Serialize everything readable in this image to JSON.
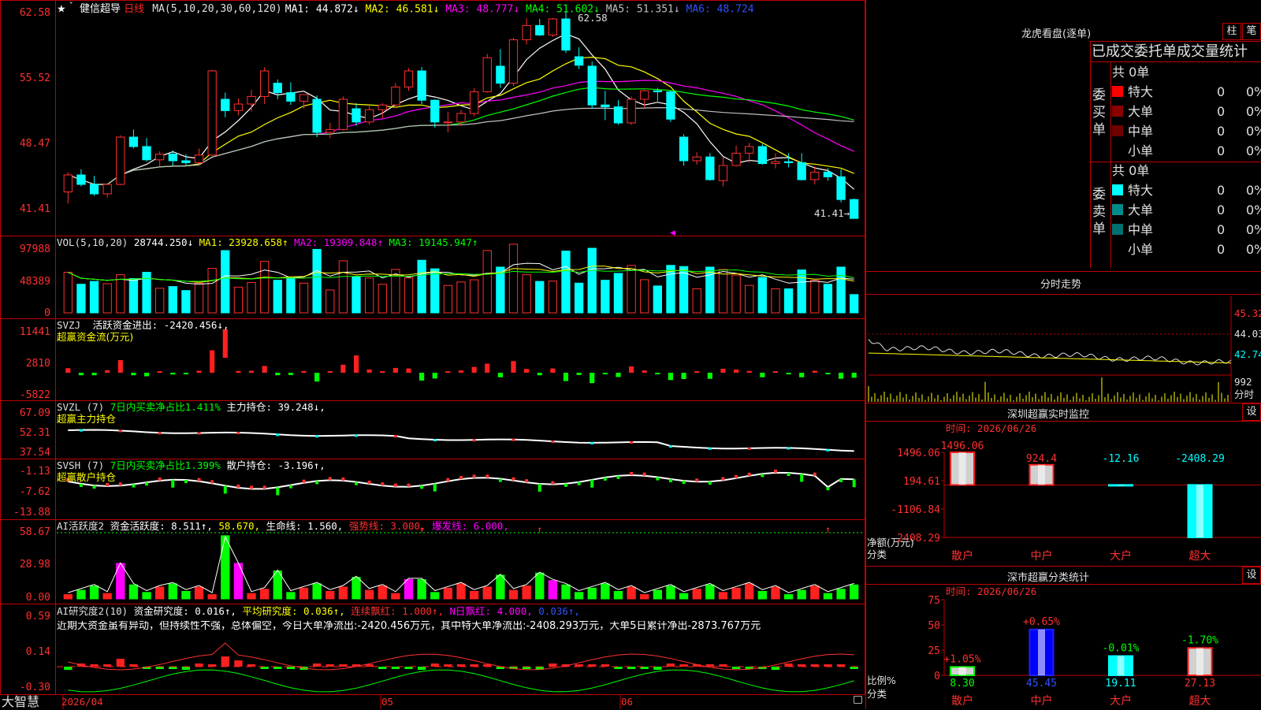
{
  "app": {
    "brand": "大智慧"
  },
  "kline": {
    "star": "★",
    "fav_mark": "˅",
    "name": "健信超导",
    "period": "日线",
    "ma_spec": "MA(5,10,20,30,60,120)",
    "ma": [
      {
        "label": "MA1: 44.872↓",
        "color": "#ffffff"
      },
      {
        "label": "MA2: 46.581↓",
        "color": "#ffff00"
      },
      {
        "label": "MA3: 48.777↓",
        "color": "#ff00ff"
      },
      {
        "label": "MA4: 51.602↓",
        "color": "#00ff00"
      },
      {
        "label": "MA5: 51.351↓",
        "color": "#c0c0c0"
      },
      {
        "label": "MA6: 48.724",
        "color": "#3050ff"
      }
    ],
    "y_ticks": [
      "62.58",
      "55.52",
      "48.47",
      "41.41"
    ],
    "high_label": "62.58",
    "low_label": "41.41→",
    "candles": [
      [
        44.2,
        46.3,
        43.0,
        46.0
      ],
      [
        46.0,
        46.6,
        44.8,
        45.0
      ],
      [
        45.0,
        45.9,
        43.8,
        44.0
      ],
      [
        44.0,
        45.1,
        43.6,
        45.0
      ],
      [
        45.0,
        50.2,
        44.9,
        50.0
      ],
      [
        50.0,
        50.8,
        48.8,
        49.0
      ],
      [
        49.0,
        49.9,
        47.4,
        47.6
      ],
      [
        47.6,
        48.5,
        46.9,
        48.2
      ],
      [
        48.2,
        48.6,
        47.0,
        47.5
      ],
      [
        47.5,
        48.2,
        47.0,
        47.3
      ],
      [
        47.3,
        48.8,
        47.1,
        48.1
      ],
      [
        48.1,
        57.1,
        48.0,
        57.0
      ],
      [
        54.0,
        54.7,
        52.1,
        52.8
      ],
      [
        52.8,
        54.1,
        52.3,
        53.5
      ],
      [
        53.5,
        55.0,
        52.7,
        54.3
      ],
      [
        54.3,
        57.4,
        53.5,
        57.0
      ],
      [
        55.7,
        56.1,
        54.0,
        54.7
      ],
      [
        54.7,
        55.8,
        53.4,
        53.8
      ],
      [
        53.8,
        54.5,
        53.0,
        54.5
      ],
      [
        54.0,
        54.4,
        50.0,
        50.5
      ],
      [
        50.5,
        51.5,
        49.9,
        50.8
      ],
      [
        50.8,
        54.3,
        50.7,
        54.0
      ],
      [
        53.0,
        53.6,
        51.2,
        51.6
      ],
      [
        51.6,
        53.4,
        51.3,
        52.9
      ],
      [
        52.9,
        53.6,
        52.0,
        53.4
      ],
      [
        53.4,
        55.7,
        53.1,
        55.3
      ],
      [
        55.3,
        57.3,
        54.9,
        57.0
      ],
      [
        57.0,
        57.4,
        53.5,
        53.9
      ],
      [
        53.9,
        54.0,
        51.0,
        51.6
      ],
      [
        51.6,
        52.7,
        50.5,
        51.6
      ],
      [
        51.6,
        52.9,
        51.2,
        52.5
      ],
      [
        52.5,
        55.2,
        52.2,
        54.8
      ],
      [
        54.8,
        58.8,
        54.7,
        58.4
      ],
      [
        57.5,
        59.3,
        55.2,
        55.7
      ],
      [
        55.7,
        60.5,
        55.4,
        60.3
      ],
      [
        60.3,
        62.6,
        59.8,
        61.8
      ],
      [
        61.8,
        62.5,
        60.7,
        60.8
      ],
      [
        60.8,
        62.6,
        60.6,
        62.5
      ],
      [
        62.5,
        63.3,
        58.9,
        59.2
      ],
      [
        58.5,
        59.5,
        57.2,
        57.6
      ],
      [
        57.5,
        58.0,
        53.0,
        53.4
      ],
      [
        53.4,
        54.9,
        51.8,
        53.2
      ],
      [
        53.2,
        53.9,
        51.3,
        51.5
      ],
      [
        51.5,
        54.3,
        51.3,
        54.0
      ],
      [
        54.0,
        55.0,
        53.1,
        54.9
      ],
      [
        54.9,
        55.2,
        53.8,
        54.8
      ],
      [
        54.8,
        54.9,
        51.6,
        51.9
      ],
      [
        50.0,
        50.3,
        47.0,
        47.5
      ],
      [
        47.5,
        48.4,
        47.1,
        47.9
      ],
      [
        47.9,
        48.3,
        45.4,
        45.5
      ],
      [
        45.4,
        47.9,
        44.8,
        47.0
      ],
      [
        47.0,
        49.1,
        46.9,
        48.3
      ],
      [
        48.3,
        49.4,
        47.3,
        49.0
      ],
      [
        49.0,
        49.3,
        47.1,
        47.2
      ],
      [
        47.2,
        48.3,
        46.7,
        47.4
      ],
      [
        47.4,
        48.3,
        46.8,
        47.3
      ],
      [
        47.3,
        48.3,
        45.4,
        45.5
      ],
      [
        45.5,
        46.9,
        45.0,
        46.3
      ],
      [
        46.3,
        46.7,
        45.4,
        45.8
      ],
      [
        45.8,
        46.6,
        43.1,
        43.4
      ],
      [
        43.4,
        43.5,
        41.4,
        41.4
      ]
    ]
  },
  "vol": {
    "title": "VOL(5,10,20)",
    "value": "28744.250↓",
    "ma1": "MA1: 23928.658↑",
    "ma2": "MA2: 19309.848↑",
    "ma3": "MA3: 19145.947↑",
    "y_ticks": [
      "97988",
      "48389",
      "0"
    ]
  },
  "svzj": {
    "title": "SVZJ",
    "line1": "活跃资金进出: -2420.456↓,",
    "line2": "超赢资金流(万元)",
    "y_ticks": [
      "11441",
      "2810",
      "-5822"
    ]
  },
  "svzl": {
    "title": "SVZL (7)",
    "ratio": "7日内买卖净占比1.411%",
    "hold": "主力持仓: 39.248↓,",
    "line2": "超赢主力持仓",
    "y_ticks": [
      "67.09",
      "52.31",
      "37.54"
    ]
  },
  "svsh": {
    "title": "SVSH (7)",
    "ratio": "7日内买卖净占比1.399%",
    "hold": "散户持仓: -3.196↑,",
    "line2": "超赢散户持仓",
    "y_ticks": [
      "-1.13",
      "-7.62",
      "-13.88"
    ]
  },
  "ai_active": {
    "title": "AI活跃度2",
    "v1": "资金活跃度: 8.511↑,",
    "v2": "58.670,",
    "v3": "生命线: 1.560,",
    "v4": "强势线: 3.000,",
    "v5": "爆发线: 6.000,",
    "y_ticks": [
      "58.67",
      "28.98",
      "0.00"
    ]
  },
  "ai_research": {
    "title": "AI研究度2(10)",
    "v1": "资金研究度: 0.016↑,",
    "v2": "平均研究度: 0.036↑,",
    "v3": "连续飘红: 1.000↑,",
    "v4": "N日飘红: 4.000,",
    "v5": "0.036↑,",
    "commentary": "近期大资金虽有异动，但持续性不强，总体偏空，今日大单净流出:-2420.456万元，其中特大单净流出:-2408.293万元，大单5日累计净出-2873.767万元",
    "y_ticks": [
      "0.59",
      "0.14",
      "-0.30"
    ]
  },
  "time_axis": {
    "labels": [
      "2026/04",
      "05",
      "06"
    ]
  },
  "right": {
    "lhb_title": "龙虎看盘(逐单)",
    "btn_col": "柱",
    "btn_pen": "笔",
    "stat_header": "已成交委托单成交量统计",
    "buy_side": {
      "label": "委买单",
      "total": "共 0单",
      "rows": [
        {
          "name": "特大",
          "color": "#ff0000",
          "qty": "0",
          "pct": "0%"
        },
        {
          "name": "大单",
          "color": "#8b0000",
          "qty": "0",
          "pct": "0%"
        },
        {
          "name": "中单",
          "color": "#700000",
          "qty": "0",
          "pct": "0%"
        },
        {
          "name": "小单",
          "color": "#000000",
          "qty": "0",
          "pct": "0%"
        }
      ]
    },
    "sell_side": {
      "label": "委卖单",
      "total": "共 0单",
      "rows": [
        {
          "name": "特大",
          "color": "#00ffff",
          "qty": "0",
          "pct": "0%"
        },
        {
          "name": "大单",
          "color": "#008b8b",
          "qty": "0",
          "pct": "0%"
        },
        {
          "name": "中单",
          "color": "#007070",
          "qty": "0",
          "pct": "0%"
        },
        {
          "name": "小单",
          "color": "#000000",
          "qty": "0",
          "pct": "0%"
        }
      ]
    },
    "intraday": {
      "title": "分时走势",
      "y_ticks": [
        "45.32",
        "44.03",
        "42.74"
      ],
      "vol_label": "992",
      "vol_unit": "分时"
    },
    "monitor": {
      "title": "深圳超赢实时监控",
      "btn": "设",
      "time": "时间: 2026/06/26",
      "y_ticks": [
        "1496.06",
        "194.61",
        "-1106.84",
        "-2408.29"
      ],
      "y_unit": "净额(万元)",
      "x_unit": "分类",
      "chart_data": {
        "type": "bar",
        "categories": [
          "散户",
          "中户",
          "大户",
          "超大"
        ],
        "values": [
          1496.06,
          924.4,
          -12.16,
          -2408.29
        ],
        "labels": [
          "1496.06",
          "924.4",
          "-12.16",
          "-2408.29"
        ],
        "ylim": [
          -2408.29,
          1496.06
        ]
      }
    },
    "classify": {
      "title": "深市超赢分类统计",
      "btn": "设",
      "time": "时间: 2026/06/26",
      "y_ticks": [
        "75",
        "50",
        "25",
        "0"
      ],
      "y_unit": "比例%",
      "x_unit": "分类",
      "chart_data": {
        "type": "bar",
        "categories": [
          "散户",
          "中户",
          "大户",
          "超大"
        ],
        "values": [
          8.3,
          45.45,
          19.11,
          27.13
        ],
        "labels": [
          "8.30",
          "45.45",
          "19.11",
          "27.13"
        ],
        "changes": [
          "+1.05%",
          "+0.65%",
          "-0.01%",
          "-1.70%"
        ],
        "ylim": [
          0,
          75
        ]
      }
    }
  }
}
